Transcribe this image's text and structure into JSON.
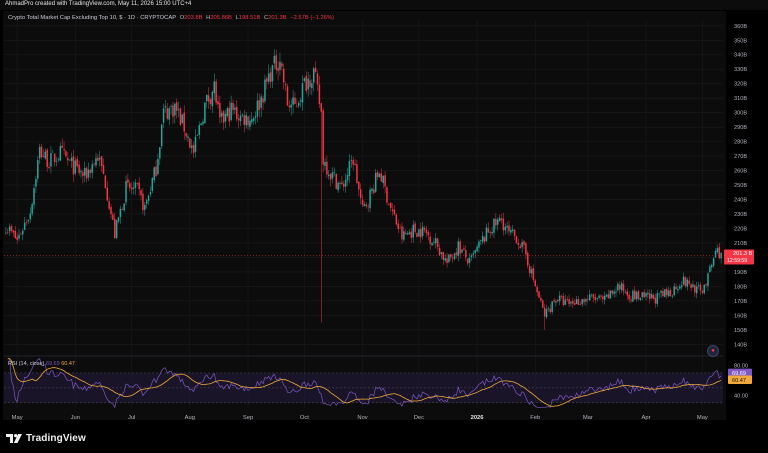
{
  "header": {
    "credit": "AhmadPro created with TradingView.com, May 11, 2026 15:00 UTC+4"
  },
  "symbol_line": {
    "name": "Crypto Total Market Cap Excluding Top 10, $ · 1D · CRYPTOCAP",
    "o_label": "O",
    "o_value": "203.8B",
    "h_label": "H",
    "h_value": "205.86B",
    "l_label": "L",
    "l_value": "198.51B",
    "c_label": "C",
    "c_value": "201.3B",
    "change": "−2.57B (−1.26%)"
  },
  "price_scale": {
    "last_price": "201.3 B",
    "countdown": "12:59:59"
  },
  "rsi": {
    "label": "RSI (14, close)",
    "value": "69.69",
    "ma_value": "60.47"
  },
  "logo": {
    "text": "TradingView",
    "icon": "tradingview-logo-icon"
  },
  "colors": {
    "up": "#26a69a",
    "down": "#f23645",
    "rsi": "#7e57c2",
    "rsi_ma": "#f2a93b",
    "background": "#0c0c0c",
    "rsi_band": "#2a1f4a"
  },
  "chart_data": [
    {
      "type": "candlestick",
      "title": "Crypto Total Market Cap Excluding Top 10, $ · 1D · CRYPTOCAP",
      "xlabel": "",
      "ylabel": "",
      "x_ticks": [
        "May",
        "Jun",
        "Jul",
        "Aug",
        "Sep",
        "Oct",
        "Nov",
        "Dec",
        "2026",
        "Feb",
        "Mar",
        "Apr",
        "May"
      ],
      "y_ticks": [
        "140B",
        "150B",
        "160B",
        "170B",
        "180B",
        "190B",
        "200B",
        "210B",
        "220B",
        "230B",
        "240B",
        "250B",
        "260B",
        "270B",
        "280B",
        "290B",
        "300B",
        "310B",
        "320B",
        "330B",
        "340B",
        "350B",
        "360B"
      ],
      "ylim": [
        134,
        364
      ],
      "last_price": 201.3,
      "close_path": [
        [
          "2025-04-25",
          222
        ],
        [
          "2025-05-01",
          212
        ],
        [
          "2025-05-08",
          232
        ],
        [
          "2025-05-13",
          274
        ],
        [
          "2025-05-18",
          266
        ],
        [
          "2025-05-24",
          272
        ],
        [
          "2025-05-29",
          265
        ],
        [
          "2025-06-06",
          256
        ],
        [
          "2025-06-13",
          270
        ],
        [
          "2025-06-17",
          252
        ],
        [
          "2025-06-22",
          216
        ],
        [
          "2025-06-28",
          248
        ],
        [
          "2025-07-04",
          246
        ],
        [
          "2025-07-08",
          234
        ],
        [
          "2025-07-14",
          262
        ],
        [
          "2025-07-18",
          300
        ],
        [
          "2025-07-24",
          304
        ],
        [
          "2025-07-29",
          290
        ],
        [
          "2025-08-03",
          272
        ],
        [
          "2025-08-09",
          305
        ],
        [
          "2025-08-14",
          318
        ],
        [
          "2025-08-17",
          292
        ],
        [
          "2025-08-23",
          302
        ],
        [
          "2025-08-28",
          297
        ],
        [
          "2025-09-03",
          296
        ],
        [
          "2025-09-08",
          310
        ],
        [
          "2025-09-13",
          328
        ],
        [
          "2025-09-18",
          338
        ],
        [
          "2025-09-22",
          306
        ],
        [
          "2025-09-26",
          304
        ],
        [
          "2025-10-01",
          320
        ],
        [
          "2025-10-06",
          328
        ],
        [
          "2025-10-10",
          300
        ],
        [
          "2025-10-11",
          268
        ],
        [
          "2025-10-15",
          258
        ],
        [
          "2025-10-21",
          248
        ],
        [
          "2025-10-27",
          268
        ],
        [
          "2025-11-01",
          232
        ],
        [
          "2025-11-06",
          246
        ],
        [
          "2025-11-10",
          260
        ],
        [
          "2025-11-16",
          234
        ],
        [
          "2025-11-22",
          214
        ],
        [
          "2025-11-28",
          219
        ],
        [
          "2025-12-04",
          218
        ],
        [
          "2025-12-10",
          210
        ],
        [
          "2025-12-16",
          196
        ],
        [
          "2025-12-22",
          208
        ],
        [
          "2025-12-28",
          196
        ],
        [
          "2026-01-03",
          210
        ],
        [
          "2026-01-08",
          220
        ],
        [
          "2026-01-14",
          226
        ],
        [
          "2026-01-18",
          216
        ],
        [
          "2026-01-22",
          214
        ],
        [
          "2026-01-27",
          202
        ],
        [
          "2026-02-01",
          180
        ],
        [
          "2026-02-06",
          160
        ],
        [
          "2026-02-12",
          172
        ],
        [
          "2026-02-18",
          168
        ],
        [
          "2026-02-24",
          170
        ],
        [
          "2026-03-03",
          172
        ],
        [
          "2026-03-10",
          170
        ],
        [
          "2026-03-17",
          180
        ],
        [
          "2026-03-24",
          174
        ],
        [
          "2026-03-31",
          172
        ],
        [
          "2026-04-07",
          172
        ],
        [
          "2026-04-14",
          176
        ],
        [
          "2026-04-20",
          184
        ],
        [
          "2026-04-26",
          180
        ],
        [
          "2026-04-30",
          176
        ],
        [
          "2026-05-04",
          186
        ],
        [
          "2026-05-08",
          204
        ],
        [
          "2026-05-10",
          204
        ],
        [
          "2026-05-11",
          201.3
        ]
      ],
      "spike_lows": [
        [
          "2025-10-10",
          155
        ],
        [
          "2026-02-06",
          150
        ]
      ]
    },
    {
      "type": "line",
      "title": "RSI (14, close)",
      "y_ticks": [
        "40.00",
        "60.00",
        "80.00"
      ],
      "ylim": [
        23,
        90
      ],
      "bands": [
        30,
        70
      ],
      "series": [
        {
          "name": "RSI (14, close)",
          "value": 69.69
        },
        {
          "name": "",
          "value": 60.47
        }
      ]
    }
  ]
}
